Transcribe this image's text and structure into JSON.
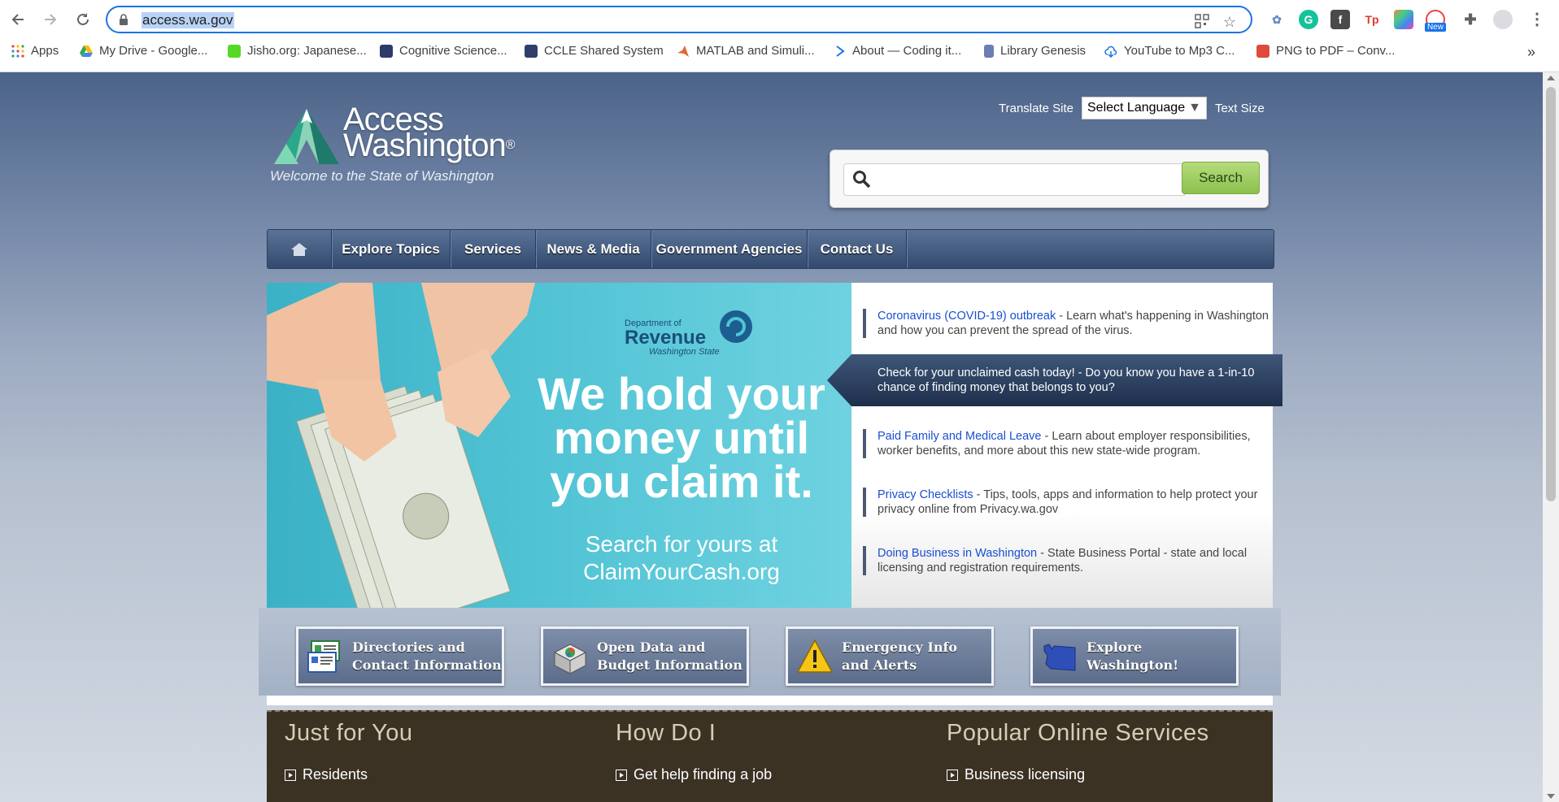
{
  "browser": {
    "url": "access.wa.gov",
    "bookmarks": [
      {
        "label": "Apps"
      },
      {
        "label": "My Drive - Google..."
      },
      {
        "label": "Jisho.org: Japanese..."
      },
      {
        "label": "Cognitive Science..."
      },
      {
        "label": "CCLE Shared System"
      },
      {
        "label": "MATLAB and Simuli..."
      },
      {
        "label": "About — Coding it..."
      },
      {
        "label": "Library Genesis"
      },
      {
        "label": "YouTube to Mp3 C..."
      },
      {
        "label": "PNG to PDF – Conv..."
      }
    ],
    "more_bookmarks": "»",
    "extension_new_badge": "New"
  },
  "header": {
    "logo_line1": "Access",
    "logo_line2": "Washington",
    "logo_mark": "®",
    "tagline": "Welcome to the State of Washington",
    "translate_label": "Translate Site",
    "language_select": "Select Language",
    "text_size": "Text Size",
    "search_placeholder": "",
    "search_button": "Search"
  },
  "nav": {
    "items": [
      "Explore Topics",
      "Services",
      "News & Media",
      "Government Agencies",
      "Contact Us"
    ]
  },
  "hero": {
    "dor_line1": "Department of",
    "dor_line2": "Revenue",
    "dor_line3": "Washington State",
    "headline_1": "We hold your",
    "headline_2": "money until",
    "headline_3": "you claim it.",
    "sub_1": "Search for yours at",
    "sub_2": "ClaimYourCash.org"
  },
  "news": [
    {
      "link": "Coronavirus (COVID-19) outbreak",
      "text": " - Learn what's happening in Washington and how you can prevent the spread of the virus."
    },
    {
      "link": "",
      "text": "Check for your unclaimed cash today! - Do you know you have a 1-in-10 chance of finding money that belongs to you?"
    },
    {
      "link": "Paid Family and Medical Leave",
      "text": " - Learn about employer responsibilities, worker benefits, and more about this new state-wide program."
    },
    {
      "link": "Privacy Checklists",
      "text": " - Tips, tools, apps and information to help protect your privacy online from Privacy.wa.gov"
    },
    {
      "link": "Doing Business in Washington",
      "text": " - State Business Portal - state and local licensing and registration requirements."
    }
  ],
  "quick_links": [
    {
      "line1": "Directories and",
      "line2": "Contact Information"
    },
    {
      "line1": "Open Data and",
      "line2": "Budget Information"
    },
    {
      "line1": "Emergency Info",
      "line2": "and Alerts"
    },
    {
      "line1": "Explore",
      "line2": "Washington!"
    }
  ],
  "bottom": {
    "col1_title": "Just for You",
    "col1_link": "Residents",
    "col2_title": "How Do I",
    "col2_link": "Get help finding a job",
    "col3_title": "Popular Online Services",
    "col3_link": "Business licensing"
  },
  "colors": {
    "nav_bar": "#324a6e",
    "search_button": "#8cc04e",
    "hero_teal": "#52c4d5",
    "bottom_panel": "#3b3224",
    "link_blue": "#1a4fd1"
  }
}
